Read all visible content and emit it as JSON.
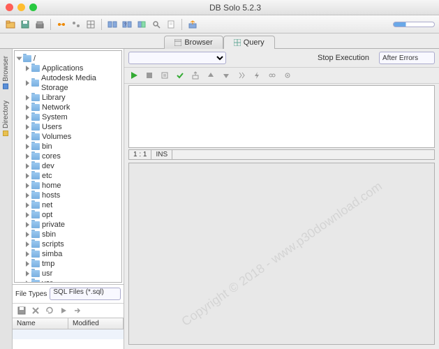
{
  "window": {
    "title": "DB Solo  5.2.3"
  },
  "tabs": {
    "browser": "Browser",
    "query": "Query"
  },
  "sidetabs": {
    "browser": "Browser",
    "directory": "Directory"
  },
  "tree": {
    "root": "/",
    "items": [
      "Applications",
      "Autodesk Media Storage",
      "Library",
      "Network",
      "System",
      "Users",
      "Volumes",
      "bin",
      "cores",
      "dev",
      "etc",
      "home",
      "hosts",
      "net",
      "opt",
      "private",
      "sbin",
      "scripts",
      "simba",
      "tmp",
      "usr",
      "var"
    ]
  },
  "filetypes": {
    "label": "File Types",
    "selected": "SQL Files (*.sql)"
  },
  "table": {
    "col_name": "Name",
    "col_modified": "Modified"
  },
  "query": {
    "stop": "Stop Execution",
    "after_errors": "After Errors"
  },
  "status": {
    "pos": "1 : 1",
    "mode": "INS"
  },
  "watermark": "Copyright © 2018 - www.p30download.com"
}
